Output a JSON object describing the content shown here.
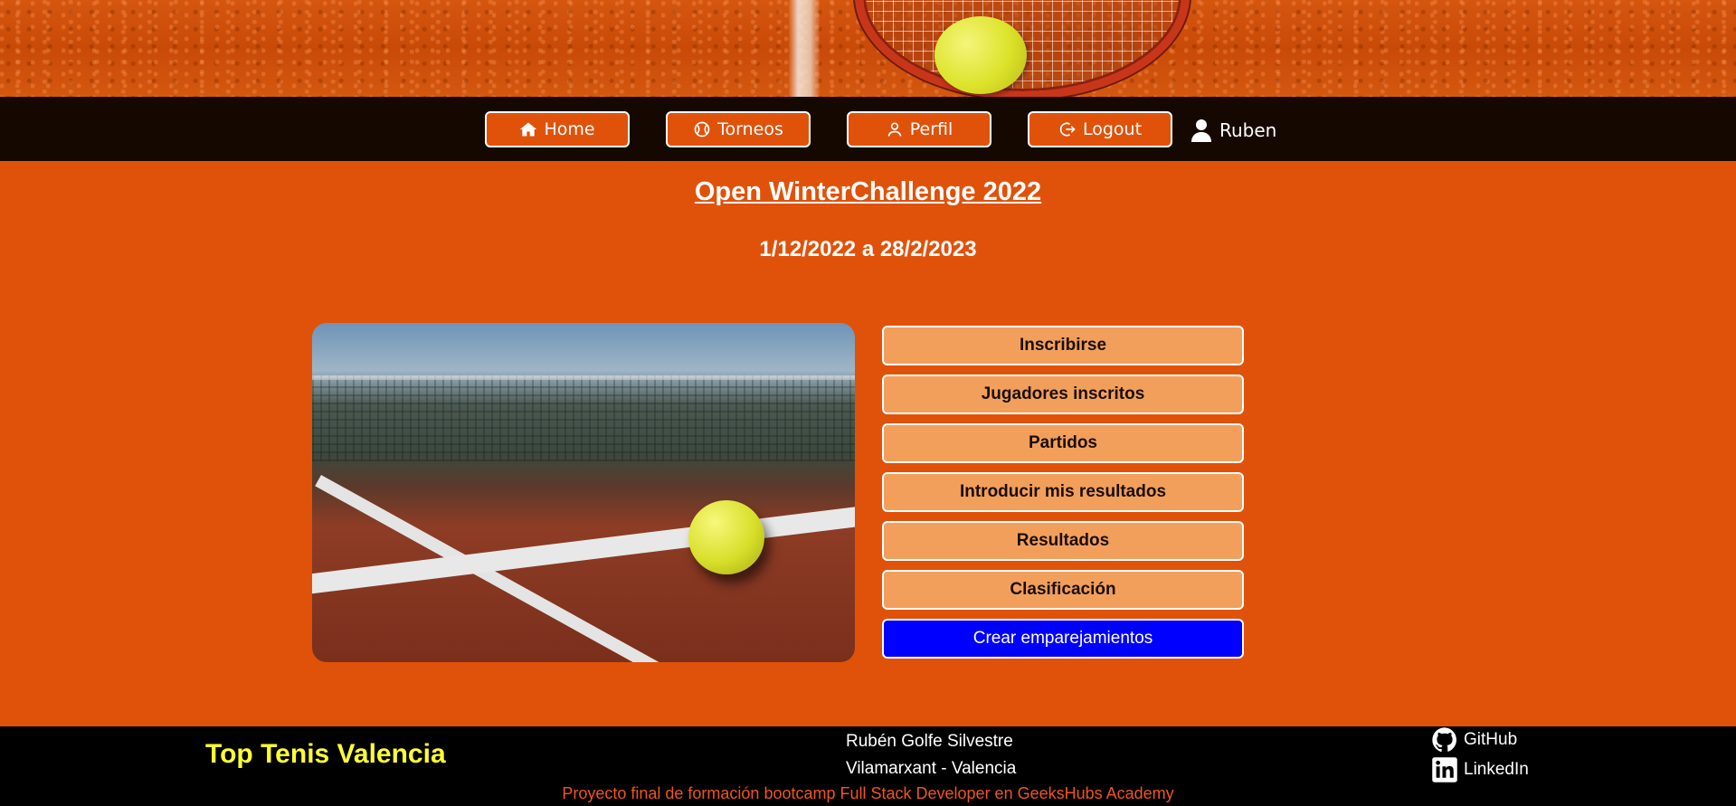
{
  "nav": {
    "home_label": "Home",
    "torneos_label": "Torneos",
    "perfil_label": "Perfil",
    "logout_label": "Logout",
    "user_name": "Ruben",
    "button_color": "#e0520a",
    "background": "#140800"
  },
  "tournament": {
    "title": "Open WinterChallenge 2022",
    "dates": "1/12/2022 a 28/2/2023"
  },
  "actions": {
    "items": [
      {
        "label": "Inscribirse"
      },
      {
        "label": "Jugadores inscritos"
      },
      {
        "label": "Partidos"
      },
      {
        "label": "Introducir mis resultados"
      },
      {
        "label": "Resultados"
      },
      {
        "label": "Clasificación"
      }
    ],
    "primary_label": "Crear emparejamientos",
    "button_color": "#f29f5c",
    "primary_color": "#0000ff"
  },
  "footer": {
    "brand": "Top Tenis Valencia",
    "author": "Rubén Golfe Silvestre",
    "location": "Vilamarxant - Valencia",
    "credit": "Proyecto final de formación bootcamp Full Stack Developer en GeeksHubs Academy",
    "github_label": "GitHub",
    "linkedin_label": "LinkedIn",
    "brand_color": "#ffff33",
    "credit_color": "#f0551d"
  },
  "theme": {
    "page_background": "#e0520a"
  }
}
